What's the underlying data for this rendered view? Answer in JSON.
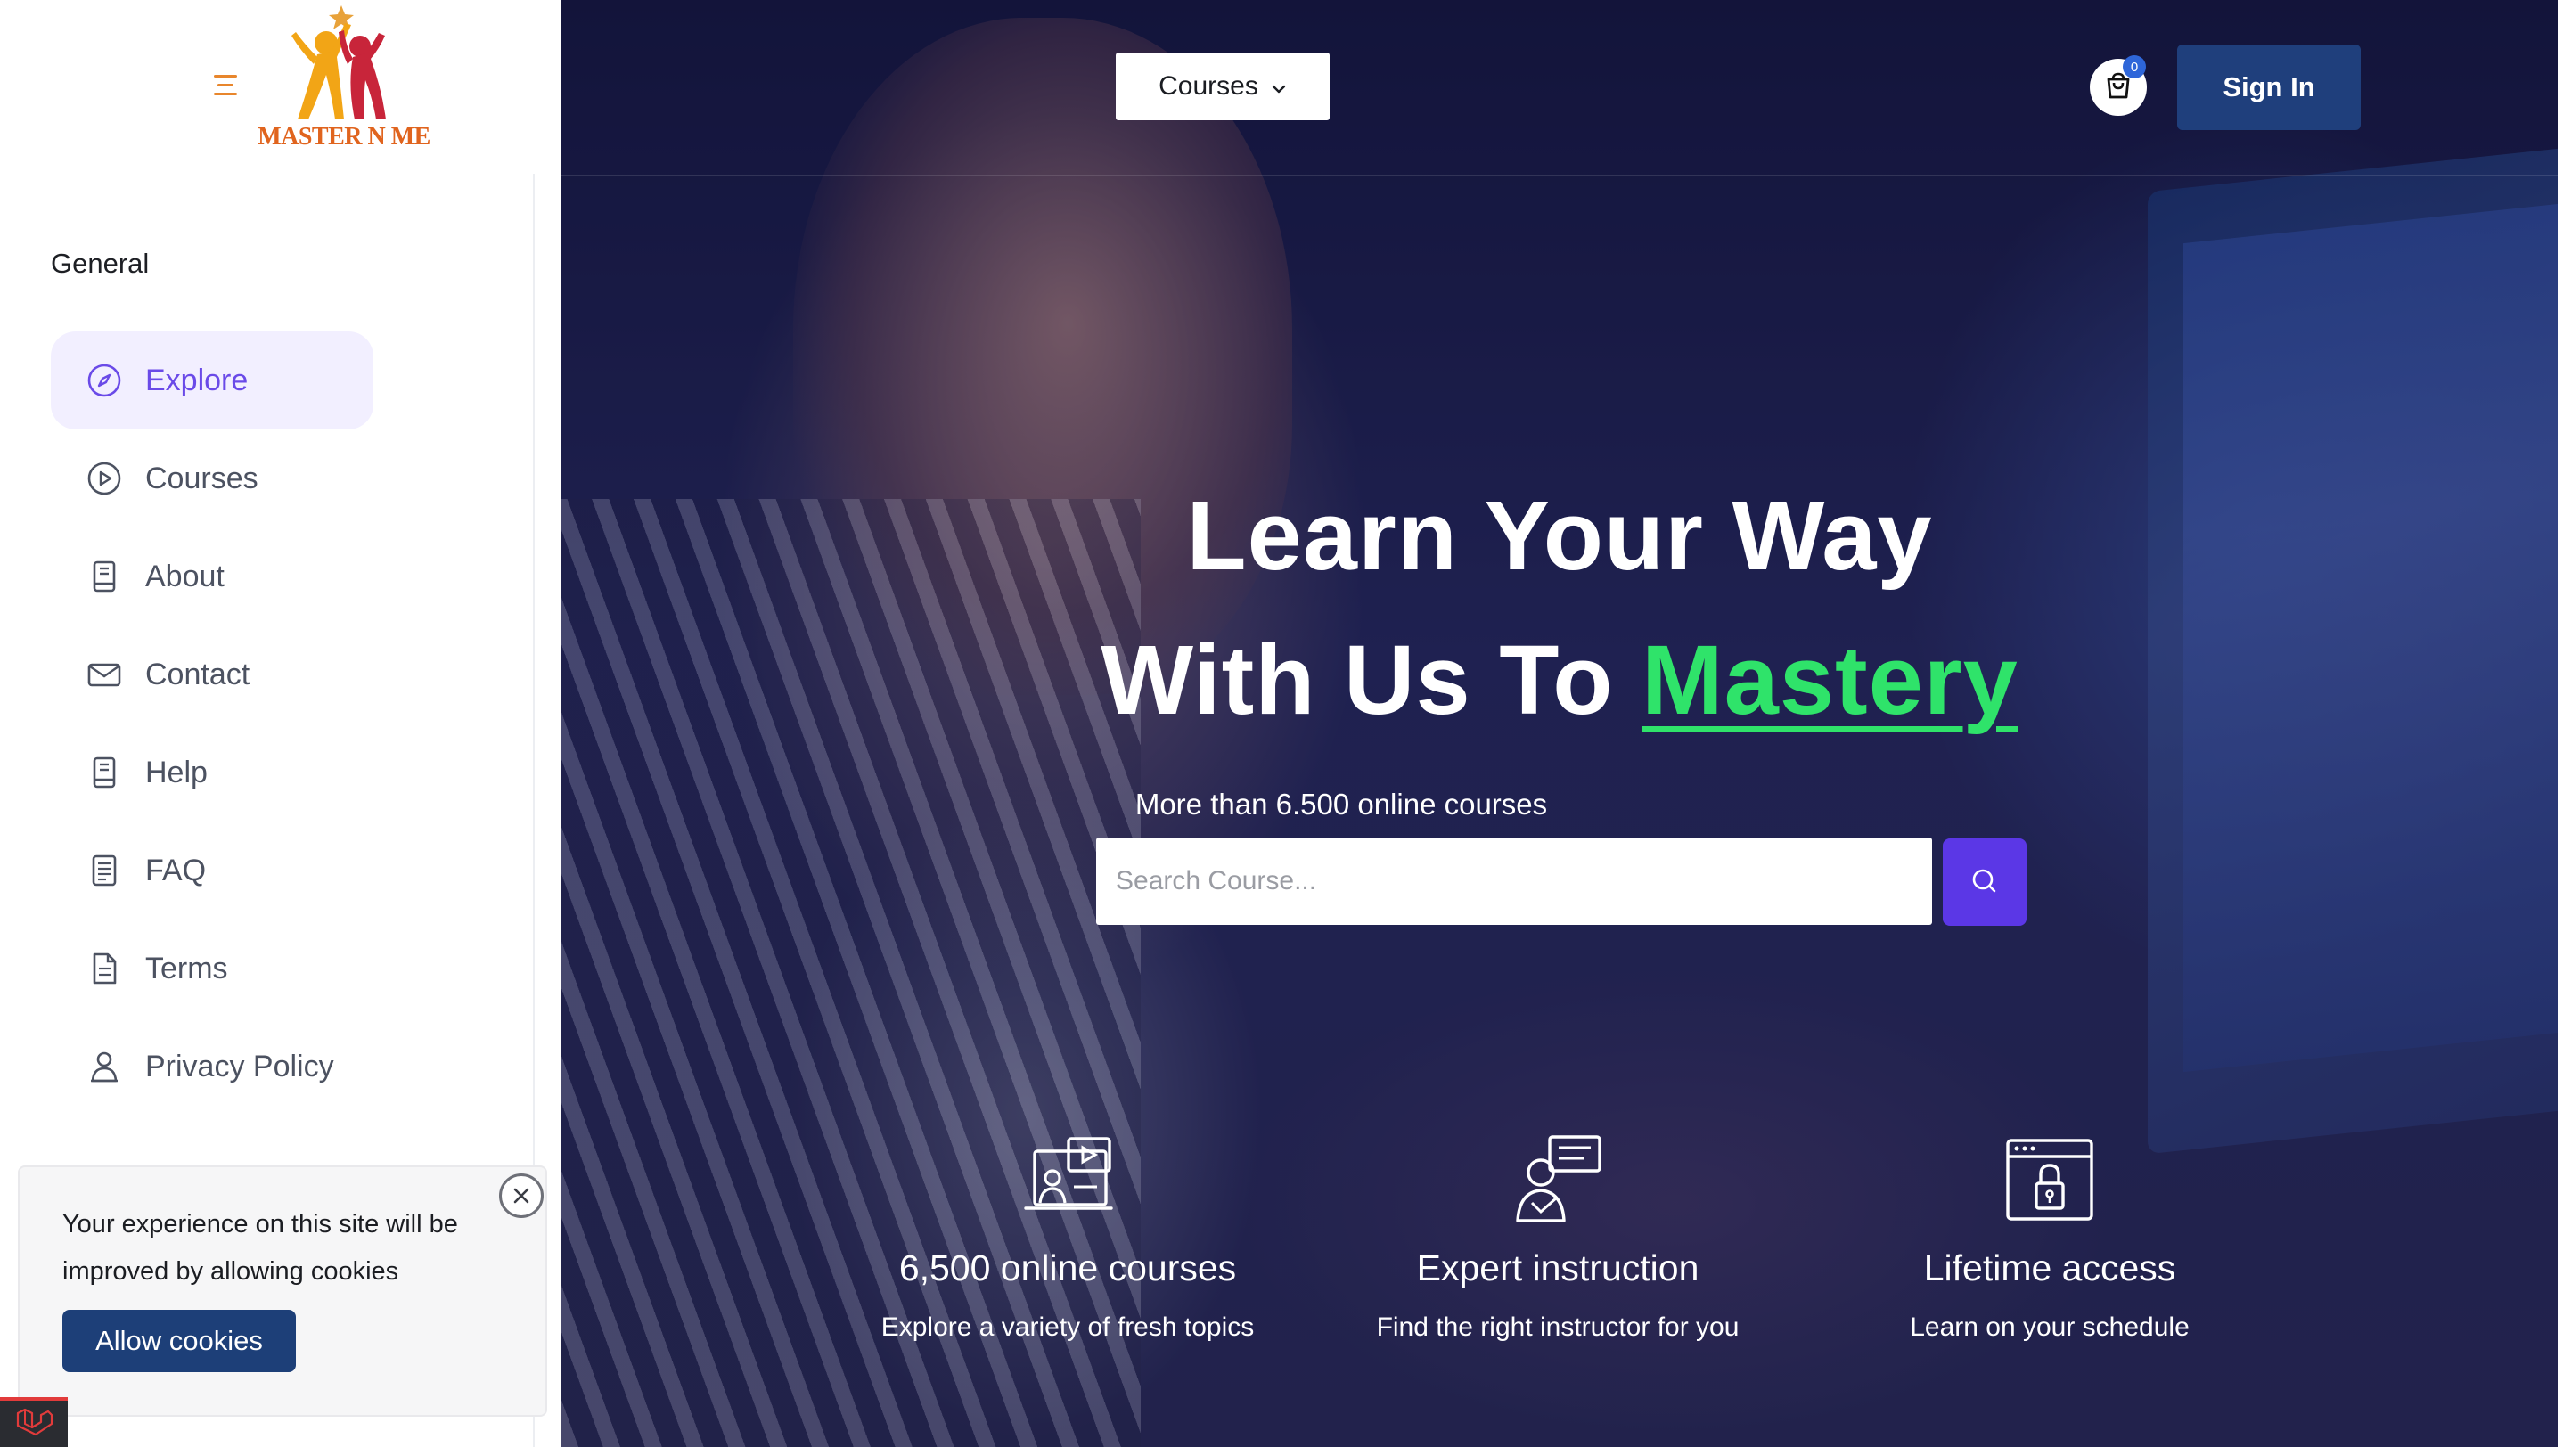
{
  "sidebar": {
    "logo_text": "MASTER N ME",
    "section_title": "General",
    "items": [
      {
        "label": "Explore",
        "icon": "compass-icon",
        "active": true
      },
      {
        "label": "Courses",
        "icon": "play-circle-icon",
        "active": false
      },
      {
        "label": "About",
        "icon": "book-icon",
        "active": false
      },
      {
        "label": "Contact",
        "icon": "envelope-icon",
        "active": false
      },
      {
        "label": "Help",
        "icon": "book-icon",
        "active": false
      },
      {
        "label": "FAQ",
        "icon": "list-document-icon",
        "active": false
      },
      {
        "label": "Terms",
        "icon": "document-icon",
        "active": false
      },
      {
        "label": "Privacy Policy",
        "icon": "user-icon",
        "active": false
      }
    ]
  },
  "cookie": {
    "message": "Your experience on this site will be improved by allowing cookies",
    "allow_label": "Allow cookies"
  },
  "header": {
    "courses_dropdown": "Courses",
    "cart_count": "0",
    "sign_in_label": "Sign In"
  },
  "hero": {
    "title_line1": "Learn Your Way",
    "title_line2_prefix": "With Us To ",
    "title_highlight": "Mastery",
    "subtitle": "More than 6.500 online courses",
    "search_placeholder": "Search Course..."
  },
  "features": [
    {
      "title": "6,500 online courses",
      "desc": "Explore a variety of fresh topics",
      "icon": "video-course-icon"
    },
    {
      "title": "Expert instruction",
      "desc": "Find the right instructor for you",
      "icon": "instructor-icon"
    },
    {
      "title": "Lifetime access",
      "desc": "Learn on your schedule",
      "icon": "lock-browser-icon"
    }
  ],
  "colors": {
    "accent_purple": "#5b37e6",
    "active_nav_bg": "#f2efff",
    "navy_button": "#1f3f7c",
    "highlight_green": "#2fe36a",
    "logo_orange": "#e0641e"
  }
}
